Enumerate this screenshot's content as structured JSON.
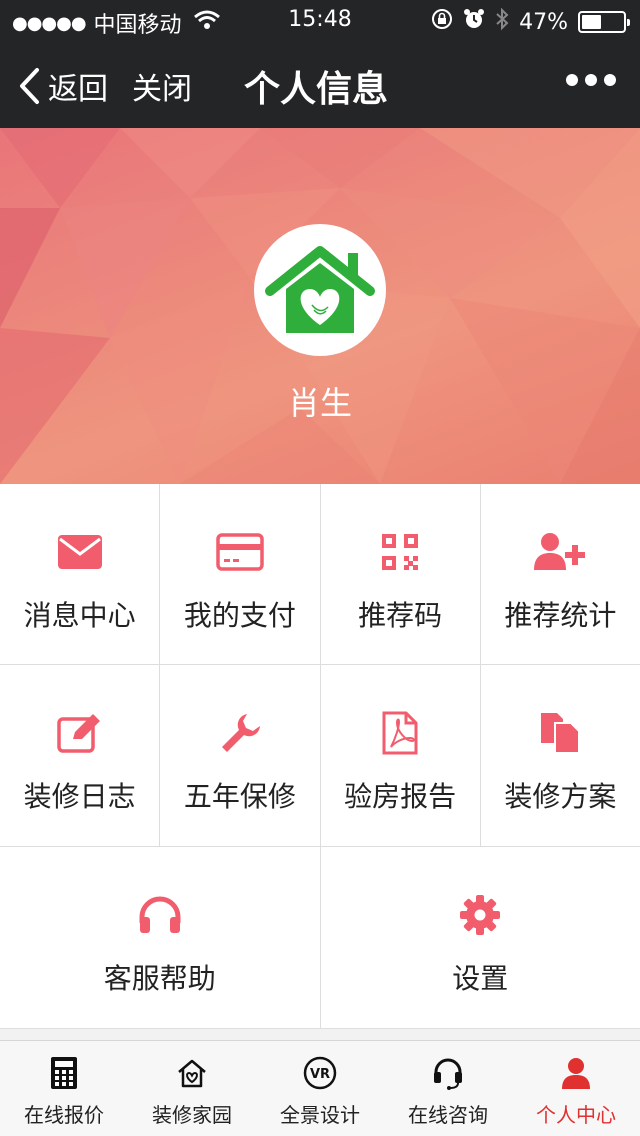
{
  "status_bar": {
    "signal": "●●●●●",
    "carrier": "中国移动",
    "time": "15:48",
    "battery_text": "47%",
    "battery_level": 0.47
  },
  "nav": {
    "back_label": "返回",
    "close_label": "关闭",
    "title": "个人信息"
  },
  "profile": {
    "username": "肖生"
  },
  "colors": {
    "accent": "#f25d6d",
    "active_tab": "#e0302f",
    "logo_green": "#2fae3c"
  },
  "menu": [
    [
      {
        "label": "消息中心",
        "icon": "envelope-icon"
      },
      {
        "label": "我的支付",
        "icon": "credit-card-icon"
      },
      {
        "label": "推荐码",
        "icon": "qr-code-icon"
      },
      {
        "label": "推荐统计",
        "icon": "add-user-icon"
      }
    ],
    [
      {
        "label": "装修日志",
        "icon": "edit-icon"
      },
      {
        "label": "五年保修",
        "icon": "wrench-icon"
      },
      {
        "label": "验房报告",
        "icon": "pdf-file-icon"
      },
      {
        "label": "装修方案",
        "icon": "copy-files-icon"
      }
    ],
    [
      {
        "label": "客服帮助",
        "icon": "headphones-icon"
      },
      {
        "label": "设置",
        "icon": "gear-icon"
      }
    ]
  ],
  "tabs": [
    {
      "label": "在线报价",
      "icon": "calculator-icon"
    },
    {
      "label": "装修家园",
      "icon": "home-heart-icon"
    },
    {
      "label": "全景设计",
      "icon": "vr-icon"
    },
    {
      "label": "在线咨询",
      "icon": "headset-icon"
    },
    {
      "label": "个人中心",
      "icon": "user-icon",
      "active": true
    }
  ]
}
